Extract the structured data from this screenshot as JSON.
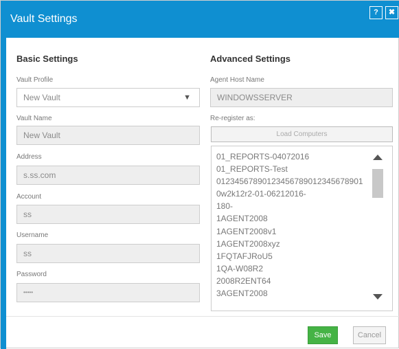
{
  "window": {
    "title": "Vault Settings",
    "help_label": "?",
    "close_label": "✖"
  },
  "basic": {
    "heading": "Basic Settings",
    "vault_profile": {
      "label": "Vault Profile",
      "value": "New Vault"
    },
    "vault_name": {
      "label": "Vault Name",
      "value": "New Vault"
    },
    "address": {
      "label": "Address",
      "value": "s.ss.com"
    },
    "account": {
      "label": "Account",
      "value": "ss"
    },
    "username": {
      "label": "Username",
      "value": "ss"
    },
    "password": {
      "label": "Password",
      "value": "•••••"
    }
  },
  "advanced": {
    "heading": "Advanced Settings",
    "agent_host": {
      "label": "Agent Host Name",
      "value": "WINDOWSSERVER"
    },
    "reregister_label": "Re-register as:",
    "load_button": "Load Computers",
    "computers": [
      "01_REPORTS-04072016",
      "01_REPORTS-Test",
      "01234567890123456789012345678901",
      "0w2k12r2-01-06212016-",
      "180-",
      "1AGENT2008",
      "1AGENT2008v1",
      "1AGENT2008xyz",
      "1FQTAFJRoU5",
      "1QA-W08R2",
      "2008R2ENT64",
      "3AGENT2008"
    ]
  },
  "footer": {
    "save": "Save",
    "cancel": "Cancel"
  },
  "colors": {
    "titlebar": "#0f8fd1",
    "save": "#45b345"
  }
}
